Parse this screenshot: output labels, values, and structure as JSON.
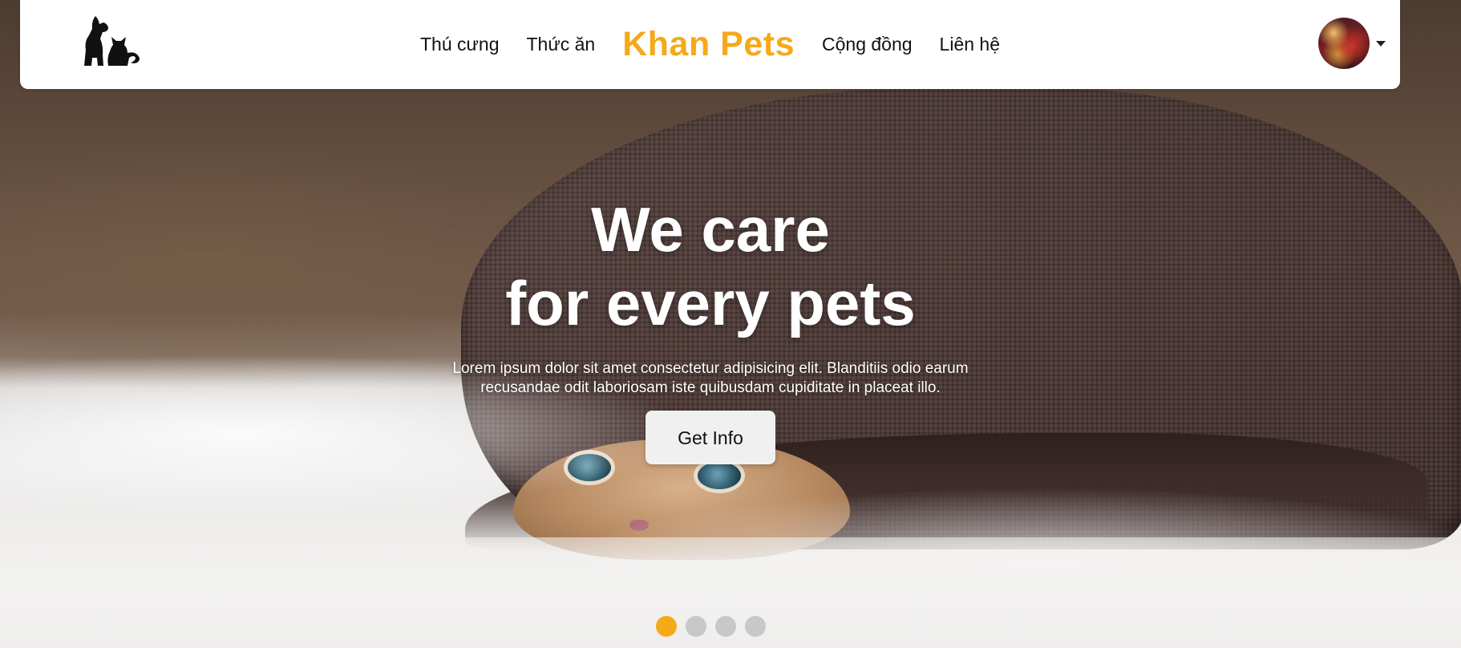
{
  "nav": {
    "links_left": [
      "Thú cưng",
      "Thức ăn"
    ],
    "brand": "Khan Pets",
    "links_right": [
      "Cộng đồng",
      "Liên hệ"
    ],
    "logo_icon": "dog-cat-logo-icon",
    "avatar_icon": "user-avatar",
    "caret_icon": "chevron-down-icon"
  },
  "hero": {
    "title_line1": "We care",
    "title_line2": "for every pets",
    "description": "Lorem ipsum dolor sit amet consectetur adipisicing elit. Blanditiis odio earum recusandae odit laboriosam iste quibusdam cupiditate in placeat illo.",
    "cta_label": "Get Info"
  },
  "carousel": {
    "slide_count": 4,
    "active_index": 0
  },
  "colors": {
    "brand": "#f5a91a",
    "dot_inactive": "#c9c8c8",
    "nav_text": "#111111",
    "hero_text": "#ffffff"
  }
}
